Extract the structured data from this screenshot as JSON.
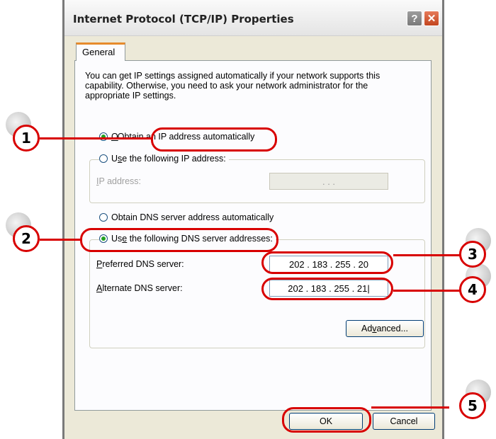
{
  "window": {
    "title": "Internet Protocol (TCP/IP) Properties",
    "help_label": "?",
    "close_label": "✕"
  },
  "tabs": [
    {
      "label": "General"
    }
  ],
  "description": "You can get IP settings assigned automatically if your network supports this capability. Otherwise, you need to ask your network administrator for the appropriate IP settings.",
  "ip": {
    "obtain_auto_label": "Obtain an IP address automatically",
    "obtain_auto_key": "O",
    "use_following_label_pre": "U",
    "use_following_key": "s",
    "use_following_label_post": "e the following IP address:",
    "ip_address_key": "I",
    "ip_address_label_post": "P address:",
    "ip_address_value": ".       .       ."
  },
  "dns": {
    "obtain_auto_key": "B",
    "obtain_auto_label_post": "btain DNS server address automatically",
    "use_following_pre": "Us",
    "use_following_key": "e",
    "use_following_post": " the following DNS server addresses:",
    "preferred_key": "P",
    "preferred_label_post": "referred DNS server:",
    "preferred_value": "202 . 183 . 255 .  20",
    "alternate_key": "A",
    "alternate_label_post": "lternate DNS server:",
    "alternate_value": "202 . 183 . 255 .  21|"
  },
  "buttons": {
    "advanced_pre": "Ad",
    "advanced_key": "v",
    "advanced_post": "anced...",
    "ok": "OK",
    "cancel": "Cancel"
  },
  "callouts": [
    "1",
    "2",
    "3",
    "4",
    "5"
  ],
  "colors": {
    "annotation": "#d80000",
    "accent_tab": "#e68b2c",
    "radio_dot": "#21a121"
  }
}
